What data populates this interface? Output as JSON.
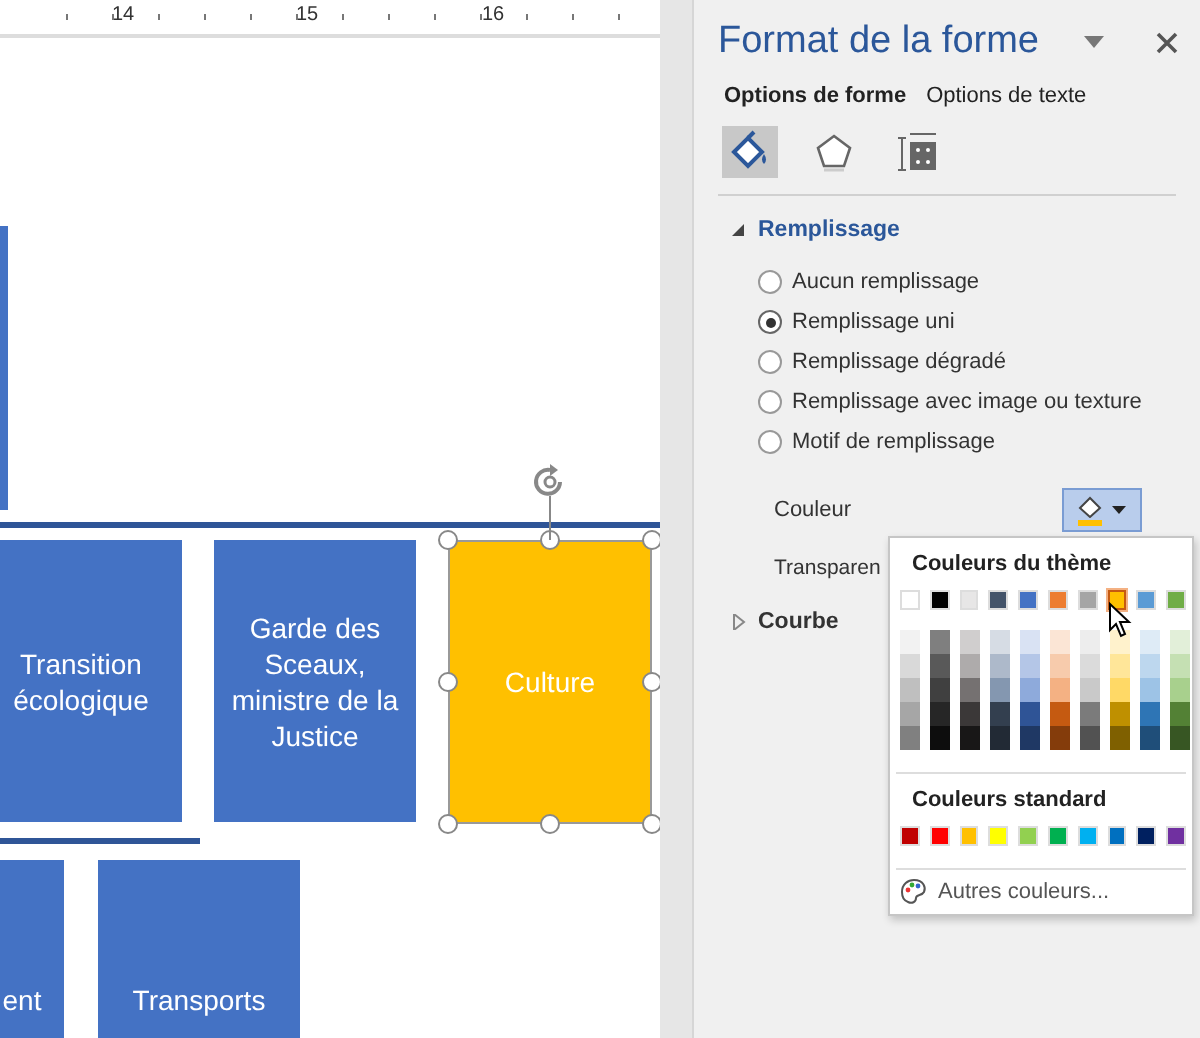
{
  "canvas": {
    "ruler_labels": [
      "14",
      "15",
      "16"
    ],
    "shapes": [
      {
        "text": "Transition écologique",
        "color": "#4472c4",
        "selected": false
      },
      {
        "text": "Garde des Sceaux, ministre de la Justice",
        "color": "#4472c4",
        "selected": false
      },
      {
        "text": "Culture",
        "color": "#ffc000",
        "selected": true
      },
      {
        "text": "ent",
        "color": "#4472c4",
        "selected": false
      },
      {
        "text": "Transports",
        "color": "#4472c4",
        "selected": false
      }
    ]
  },
  "panel": {
    "title": "Format de la forme",
    "tabs": [
      {
        "label": "Options de forme",
        "selected": true
      },
      {
        "label": "Options de texte",
        "selected": false
      }
    ],
    "icon_tabs": [
      {
        "kind": "fill",
        "selected": true
      },
      {
        "kind": "effects",
        "selected": false
      },
      {
        "kind": "size",
        "selected": false
      }
    ],
    "fill": {
      "title": "Remplissage",
      "expanded": true,
      "options": [
        {
          "label": "Aucun remplissage",
          "selected": false
        },
        {
          "label": "Remplissage uni",
          "selected": true
        },
        {
          "label": "Remplissage dégradé",
          "selected": false
        },
        {
          "label": "Remplissage avec image ou texture",
          "selected": false
        },
        {
          "label": "Motif de remplissage",
          "selected": false
        }
      ],
      "color_label": "Couleur",
      "color_button": {
        "color": "#ffc000"
      },
      "transparency_label": "Transparen"
    },
    "line": {
      "title": "Courbe",
      "expanded": false
    }
  },
  "color_menu": {
    "theme_title": "Couleurs du thème",
    "theme_colors": [
      {
        "color": "#ffffff",
        "selected": false
      },
      {
        "color": "#000000",
        "selected": false
      },
      {
        "color": "#e7e6e6",
        "selected": false
      },
      {
        "color": "#44546a",
        "selected": false
      },
      {
        "color": "#4472c4",
        "selected": false
      },
      {
        "color": "#ed7d31",
        "selected": false
      },
      {
        "color": "#a5a5a5",
        "selected": false
      },
      {
        "color": "#ffc000",
        "selected": true
      },
      {
        "color": "#5b9bd5",
        "selected": false
      },
      {
        "color": "#70ad47",
        "selected": false
      }
    ],
    "shades": [
      [
        {
          "color": "#f2f2f2"
        },
        {
          "color": "#d9d9d9"
        },
        {
          "color": "#bfbfbf"
        },
        {
          "color": "#a6a6a6"
        },
        {
          "color": "#808080"
        }
      ],
      [
        {
          "color": "#7f7f7f"
        },
        {
          "color": "#595959"
        },
        {
          "color": "#404040"
        },
        {
          "color": "#262626"
        },
        {
          "color": "#0d0d0d"
        }
      ],
      [
        {
          "color": "#d0cece"
        },
        {
          "color": "#aeabab"
        },
        {
          "color": "#757171"
        },
        {
          "color": "#3b3838"
        },
        {
          "color": "#181717"
        }
      ],
      [
        {
          "color": "#d6dce4"
        },
        {
          "color": "#adb9ca"
        },
        {
          "color": "#8497b0"
        },
        {
          "color": "#333f4f"
        },
        {
          "color": "#222a35"
        }
      ],
      [
        {
          "color": "#d9e2f3"
        },
        {
          "color": "#b4c6e7"
        },
        {
          "color": "#8eaadb"
        },
        {
          "color": "#2f5496"
        },
        {
          "color": "#1f3864"
        }
      ],
      [
        {
          "color": "#fbe5d5"
        },
        {
          "color": "#f7cbac"
        },
        {
          "color": "#f4b183"
        },
        {
          "color": "#c55a11"
        },
        {
          "color": "#843c0b"
        }
      ],
      [
        {
          "color": "#ededed"
        },
        {
          "color": "#dbdbdb"
        },
        {
          "color": "#c9c9c9"
        },
        {
          "color": "#7b7b7b"
        },
        {
          "color": "#525252"
        }
      ],
      [
        {
          "color": "#fff2cc"
        },
        {
          "color": "#ffe699"
        },
        {
          "color": "#ffd966"
        },
        {
          "color": "#bf9000"
        },
        {
          "color": "#7f6000"
        }
      ],
      [
        {
          "color": "#deebf6"
        },
        {
          "color": "#bdd7ee"
        },
        {
          "color": "#9dc3e6"
        },
        {
          "color": "#2e75b5"
        },
        {
          "color": "#1f4e79"
        }
      ],
      [
        {
          "color": "#e2efd9"
        },
        {
          "color": "#c5e0b3"
        },
        {
          "color": "#a8d08d"
        },
        {
          "color": "#538135"
        },
        {
          "color": "#375623"
        }
      ]
    ],
    "standard_title": "Couleurs standard",
    "standard_colors": [
      {
        "color": "#c00000"
      },
      {
        "color": "#ff0000"
      },
      {
        "color": "#ffc000"
      },
      {
        "color": "#ffff00"
      },
      {
        "color": "#92d050"
      },
      {
        "color": "#00b050"
      },
      {
        "color": "#00b0f0"
      },
      {
        "color": "#0070c0"
      },
      {
        "color": "#002060"
      },
      {
        "color": "#7030a0"
      }
    ],
    "more": "Autres couleurs..."
  }
}
